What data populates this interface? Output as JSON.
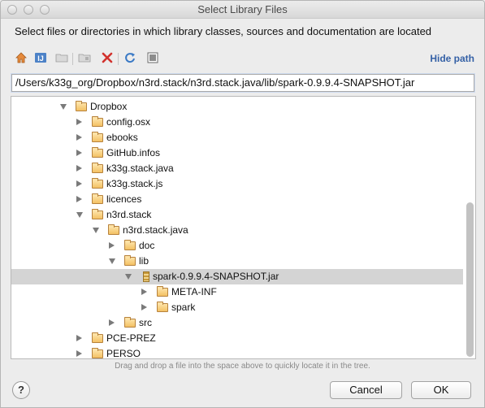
{
  "window": {
    "title": "Select Library Files"
  },
  "description": "Select files or directories in which library classes, sources and documentation are located",
  "toolbar": {
    "icons": [
      "home-icon",
      "project-icon",
      "new-folder-icon",
      "new-module-folder-icon",
      "delete-icon",
      "refresh-icon",
      "show-hidden-icon"
    ],
    "hide_path_label": "Hide path"
  },
  "path": {
    "value": "/Users/k33g_org/Dropbox/n3rd.stack/n3rd.stack.java/lib/spark-0.9.9.4-SNAPSHOT.jar"
  },
  "tree": {
    "rows": [
      {
        "label": "Dropbox",
        "level": 0,
        "state": "expanded",
        "kind": "folder",
        "selected": false
      },
      {
        "label": "config.osx",
        "level": 1,
        "state": "collapsed",
        "kind": "folder",
        "selected": false
      },
      {
        "label": "ebooks",
        "level": 1,
        "state": "collapsed",
        "kind": "folder",
        "selected": false
      },
      {
        "label": "GitHub.infos",
        "level": 1,
        "state": "collapsed",
        "kind": "folder",
        "selected": false
      },
      {
        "label": "k33g.stack.java",
        "level": 1,
        "state": "collapsed",
        "kind": "folder",
        "selected": false
      },
      {
        "label": "k33g.stack.js",
        "level": 1,
        "state": "collapsed",
        "kind": "folder",
        "selected": false
      },
      {
        "label": "licences",
        "level": 1,
        "state": "collapsed",
        "kind": "folder",
        "selected": false
      },
      {
        "label": "n3rd.stack",
        "level": 1,
        "state": "expanded",
        "kind": "folder",
        "selected": false
      },
      {
        "label": "n3rd.stack.java",
        "level": 2,
        "state": "expanded",
        "kind": "folder",
        "selected": false
      },
      {
        "label": "doc",
        "level": 3,
        "state": "collapsed",
        "kind": "folder",
        "selected": false
      },
      {
        "label": "lib",
        "level": 3,
        "state": "expanded",
        "kind": "folder",
        "selected": false
      },
      {
        "label": "spark-0.9.9.4-SNAPSHOT.jar",
        "level": 4,
        "state": "expanded",
        "kind": "jar",
        "selected": true
      },
      {
        "label": "META-INF",
        "level": 5,
        "state": "collapsed",
        "kind": "folder",
        "selected": false
      },
      {
        "label": "spark",
        "level": 5,
        "state": "collapsed",
        "kind": "folder",
        "selected": false
      },
      {
        "label": "src",
        "level": 3,
        "state": "collapsed",
        "kind": "folder",
        "selected": false
      },
      {
        "label": "PCE-PREZ",
        "level": 1,
        "state": "collapsed",
        "kind": "folder",
        "selected": false
      },
      {
        "label": "PERSO",
        "level": 1,
        "state": "collapsed",
        "kind": "folder",
        "selected": false
      }
    ]
  },
  "hint": "Drag and drop a file into the space above to quickly locate it in the tree.",
  "buttons": {
    "help": "?",
    "cancel": "Cancel",
    "ok": "OK"
  }
}
